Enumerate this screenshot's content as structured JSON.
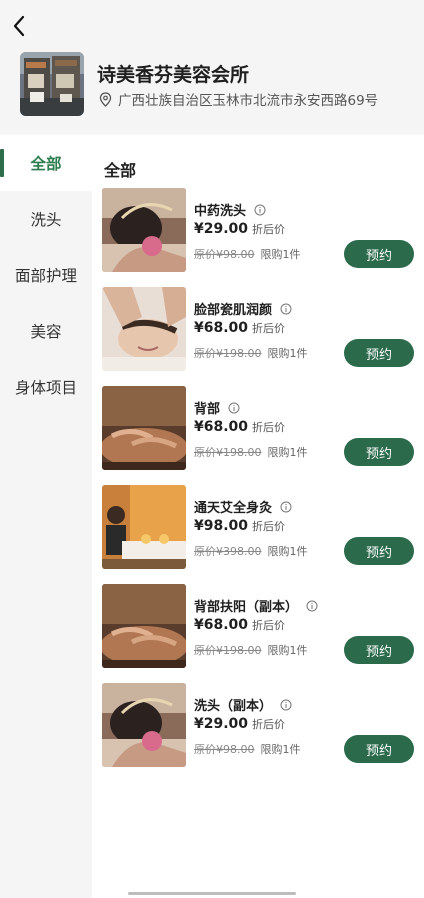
{
  "store": {
    "name": "诗美香芬美容会所",
    "address": "广西壮族自治区玉林市北流市永安西路69号"
  },
  "sidebar": {
    "items": [
      {
        "label": "全部",
        "active": true
      },
      {
        "label": "洗头",
        "active": false
      },
      {
        "label": "面部护理",
        "active": false
      },
      {
        "label": "美容",
        "active": false
      },
      {
        "label": "身体项目",
        "active": false
      }
    ]
  },
  "main": {
    "section_title": "全部",
    "price_tag": "折后价",
    "book_label": "预约",
    "services": [
      {
        "title": "中药洗头",
        "price": "¥29.00",
        "orig": "原价¥98.00",
        "limit": "限购1件",
        "image": "hair-wash"
      },
      {
        "title": "脸部瓷肌润颜",
        "price": "¥68.00",
        "orig": "原价¥198.00",
        "limit": "限购1件",
        "image": "facial"
      },
      {
        "title": "背部",
        "price": "¥68.00",
        "orig": "原价¥198.00",
        "limit": "限购1件",
        "image": "back-massage"
      },
      {
        "title": "通天艾全身灸",
        "price": "¥98.00",
        "orig": "原价¥398.00",
        "limit": "限购1件",
        "image": "moxibustion"
      },
      {
        "title": "背部扶阳（副本）",
        "price": "¥68.00",
        "orig": "原价¥198.00",
        "limit": "限购1件",
        "image": "back-massage"
      },
      {
        "title": "洗头（副本）",
        "price": "¥29.00",
        "orig": "原价¥98.00",
        "limit": "限购1件",
        "image": "hair-wash"
      }
    ]
  },
  "colors": {
    "accent": "#2b6b4c",
    "active_text": "#2e7d4f",
    "background": "#f5f5f5"
  },
  "icons": {
    "back": "chevron-left-icon",
    "location": "map-pin-icon",
    "info": "info-circle-icon"
  }
}
